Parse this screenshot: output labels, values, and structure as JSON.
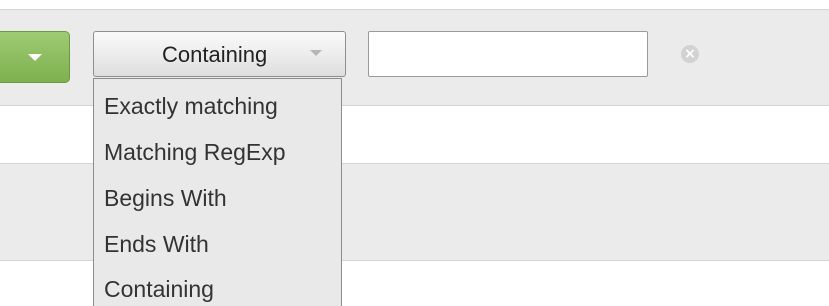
{
  "filter": {
    "green_button_icon": "chevron-down-icon",
    "green_button_color": "#8fc061",
    "match_select": {
      "selected": "Containing",
      "options": [
        "Exactly matching",
        "Matching RegExp",
        "Begins With",
        "Ends With",
        "Containing"
      ]
    },
    "value_input": {
      "value": "",
      "placeholder": ""
    },
    "clear_icon": "clear-circle-icon"
  }
}
